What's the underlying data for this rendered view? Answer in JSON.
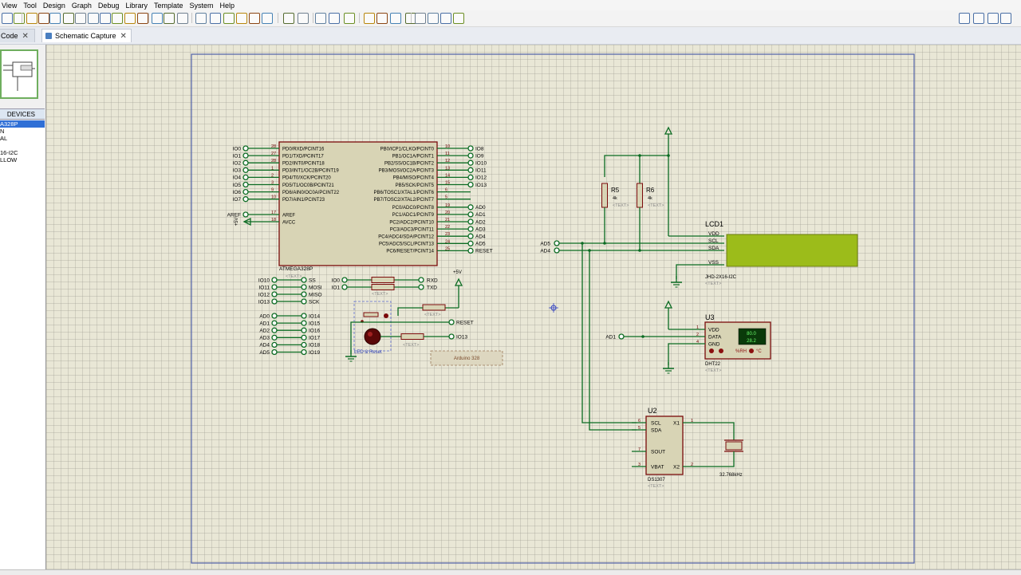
{
  "menu": [
    "View",
    "Tool",
    "Design",
    "Graph",
    "Debug",
    "Library",
    "Template",
    "System",
    "Help"
  ],
  "tabs": [
    {
      "label": "Code",
      "close": "✕"
    },
    {
      "label": "Schematic Capture",
      "close": "✕"
    }
  ],
  "devices": {
    "header": "DEVICES",
    "items": [
      "A328P",
      "N",
      "AL",
      "",
      "16-I2C",
      "LLOW"
    ],
    "selected_index": 0
  },
  "mcu": {
    "name": "ATMEGA328P",
    "text": "<TEXT>",
    "left_pins": [
      {
        "net": "IO0",
        "num": "28",
        "label": "PD0/RXD/PCINT16"
      },
      {
        "net": "IO1",
        "num": "27",
        "label": "PD1/TXD/PCINT17"
      },
      {
        "net": "IO2",
        "num": "28",
        "label": "PD2/INT0/PCINT18"
      },
      {
        "net": "IO3",
        "num": "1",
        "label": "PD3/INT1/OC2B/PCINT19"
      },
      {
        "net": "IO4",
        "num": "2",
        "label": "PD4/T0/XCK/PCINT20"
      },
      {
        "net": "IO5",
        "num": "3",
        "label": "PD5/T1/OC0B/PCINT21"
      },
      {
        "net": "IO6",
        "num": "9",
        "label": "PD6/AIN0/OC0A/PCINT22"
      },
      {
        "net": "IO7",
        "num": "10",
        "label": "PD7/AIN1/PCINT23"
      }
    ],
    "power_pins": [
      {
        "net": "AREF",
        "num": "17",
        "label": "AREF"
      },
      {
        "net": "+5V",
        "num": "18",
        "label": "AVCC"
      }
    ],
    "right_pins": [
      {
        "net": "IO8",
        "num": "10",
        "label": "PB0/ICP1/CLKO/PCINT0"
      },
      {
        "net": "IO9",
        "num": "11",
        "label": "PB1/OC1A/PCINT1"
      },
      {
        "net": "IO10",
        "num": "12",
        "label": "PB2/SS/OC1B/PCINT2"
      },
      {
        "net": "IO11",
        "num": "13",
        "label": "PB3/MOSI/OC2A/PCINT3"
      },
      {
        "net": "IO12",
        "num": "14",
        "label": "PB4/MISO/PCINT4"
      },
      {
        "net": "IO13",
        "num": "15",
        "label": "PB5/SCK/PCINT5"
      },
      {
        "net": "",
        "num": "6",
        "label": "PB6/TOSC1/XTAL1/PCINT6"
      },
      {
        "net": "",
        "num": "5",
        "label": "PB7/TOSC2/XTAL2/PCINT7"
      },
      {
        "net": "AD0",
        "num": "19",
        "label": "PC0/ADC0/PCINT8"
      },
      {
        "net": "AD1",
        "num": "20",
        "label": "PC1/ADC1/PCINT9"
      },
      {
        "net": "AD2",
        "num": "21",
        "label": "PC2/ADC2/PCINT10"
      },
      {
        "net": "AD3",
        "num": "22",
        "label": "PC3/ADC3/PCINT11"
      },
      {
        "net": "AD4",
        "num": "23",
        "label": "PC4/ADC4/SDA/PCINT12"
      },
      {
        "net": "AD5",
        "num": "24",
        "label": "PC5/ADC5/SCL/PCINT13"
      },
      {
        "net": "RESET",
        "num": "25",
        "label": "PC6/RESET/PCINT14"
      }
    ]
  },
  "io_map": [
    {
      "left": "IO10",
      "right": "SS"
    },
    {
      "left": "IO11",
      "right": "MOSI"
    },
    {
      "left": "IO12",
      "right": "MISO"
    },
    {
      "left": "IO13",
      "right": "SCK"
    }
  ],
  "ad_map": [
    {
      "left": "AD0",
      "right": "IO14"
    },
    {
      "left": "AD1",
      "right": "IO15"
    },
    {
      "left": "AD2",
      "right": "IO16"
    },
    {
      "left": "AD3",
      "right": "IO17"
    },
    {
      "left": "AD4",
      "right": "IO18"
    },
    {
      "left": "AD5",
      "right": "IO19"
    }
  ],
  "serial": [
    {
      "left": "IO0",
      "right": "RXD"
    },
    {
      "left": "IO1",
      "right": "TXD"
    }
  ],
  "reset_section": {
    "supply": "+5V",
    "reset_label": "RESET",
    "io13_label": "IO13",
    "led_label": "LED & Reset",
    "text": "<TEXT>",
    "block_label": "Arduino 328"
  },
  "resistors": [
    {
      "ref": "R5",
      "value": "4k",
      "text": "<TEXT>"
    },
    {
      "ref": "R6",
      "value": "4k",
      "text": "<TEXT>"
    }
  ],
  "lcd": {
    "ref": "LCD1",
    "part": "JHD-2X16-I2C",
    "text": "<TEXT>",
    "pins": [
      "VDD",
      "SCL",
      "SDA",
      "VSS"
    ],
    "screen_color": "#9cbc1a"
  },
  "bus_labels": [
    "AD5",
    "AD4"
  ],
  "dht": {
    "ref": "U3",
    "part": "DHT22",
    "text": "<TEXT>",
    "net": "AD1",
    "pins": [
      {
        "num": "1",
        "label": "VDD"
      },
      {
        "num": "2",
        "label": "DATA"
      },
      {
        "num": "4",
        "label": "GND"
      }
    ],
    "temp": "80.0",
    "hum": "28.2",
    "rh_label": "%RH",
    "c_label": "°C"
  },
  "rtc": {
    "ref": "U2",
    "part": "DS1307",
    "text": "<TEXT>",
    "left_pins": [
      {
        "num": "6",
        "label": "SCL"
      },
      {
        "num": "5",
        "label": "SDA"
      },
      {
        "num": "7",
        "label": "SOUT"
      },
      {
        "num": "3",
        "label": "VBAT"
      }
    ],
    "right_pins": [
      {
        "num": "1",
        "label": "X1"
      },
      {
        "num": "2",
        "label": "X2"
      }
    ],
    "crystal": "32.768kHz"
  },
  "colors": {
    "wire": "#0b6b22",
    "body": "#d8d4b5",
    "border": "#7a0a0a",
    "ref": "#000000",
    "pinnum": "#6a0000",
    "canvas": "#e9e7d6",
    "sheet_border": "#5060a8"
  }
}
